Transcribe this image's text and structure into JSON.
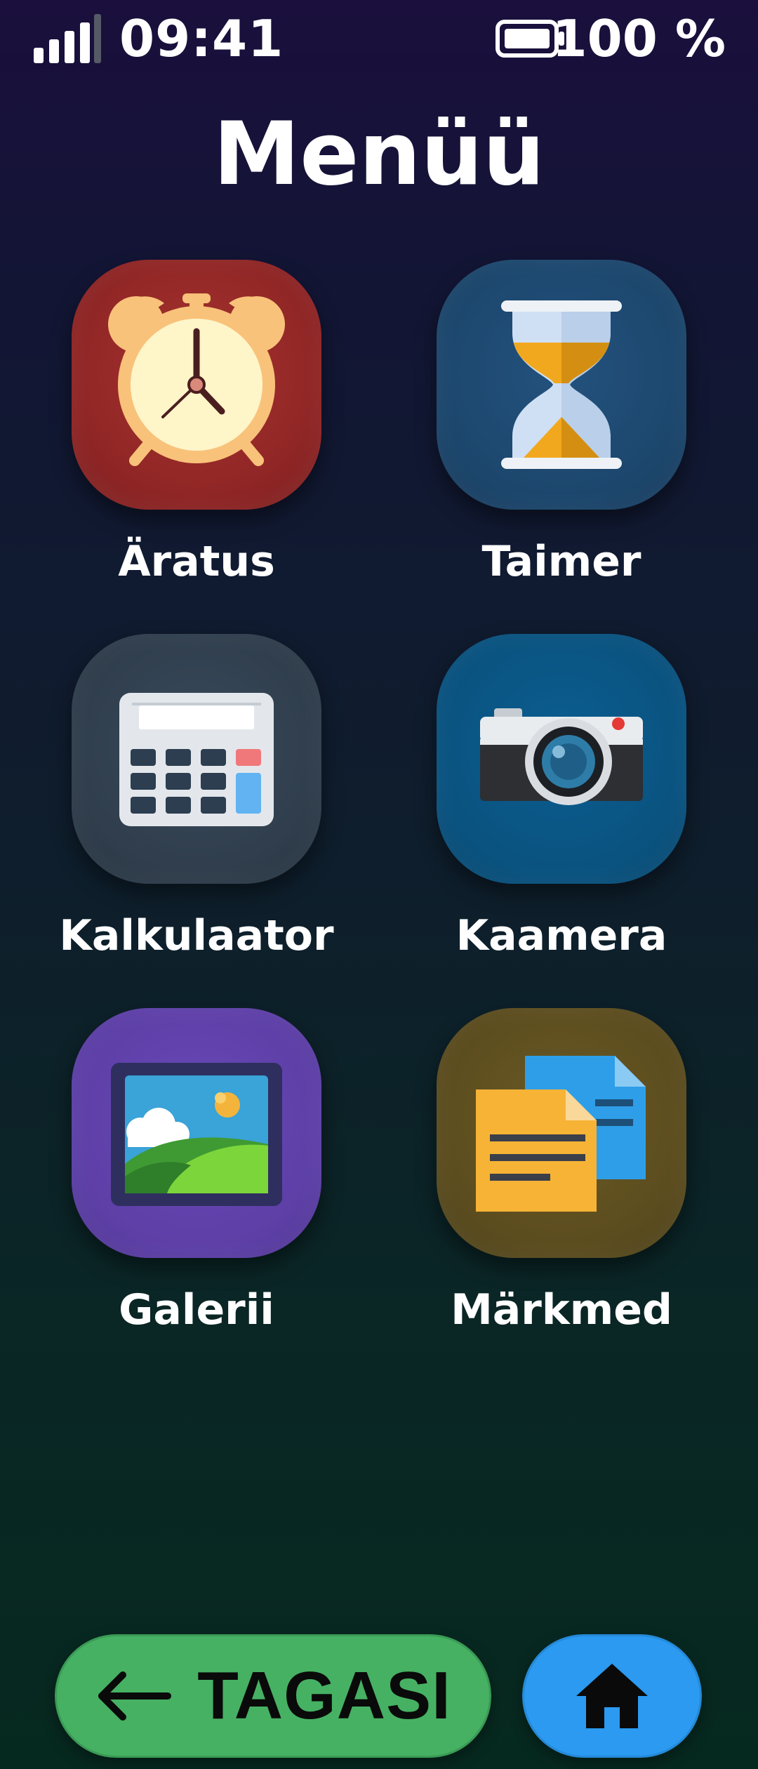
{
  "status_bar": {
    "time": "09:41",
    "battery_text": "100 %",
    "signal_icon": "signal-bars-icon",
    "battery_icon": "battery-full-icon"
  },
  "title": "Menüü",
  "apps": [
    {
      "label": "Äratus",
      "icon": "alarm-clock-icon",
      "color": "#8e2525"
    },
    {
      "label": "Taimer",
      "icon": "hourglass-icon",
      "color": "#1c466c"
    },
    {
      "label": "Kalkulaator",
      "icon": "calculator-icon",
      "color": "#2f3d4c"
    },
    {
      "label": "Kaamera",
      "icon": "camera-icon",
      "color": "#0a527f"
    },
    {
      "label": "Galerii",
      "icon": "picture-icon",
      "color": "#5d3fa6"
    },
    {
      "label": "Märkmed",
      "icon": "notes-icon",
      "color": "#5b4c1f"
    }
  ],
  "navigation": {
    "back_label": "TAGASI",
    "back_icon": "arrow-left-icon",
    "home_icon": "home-icon",
    "back_color": "#46b163",
    "home_color": "#2b9af0"
  }
}
